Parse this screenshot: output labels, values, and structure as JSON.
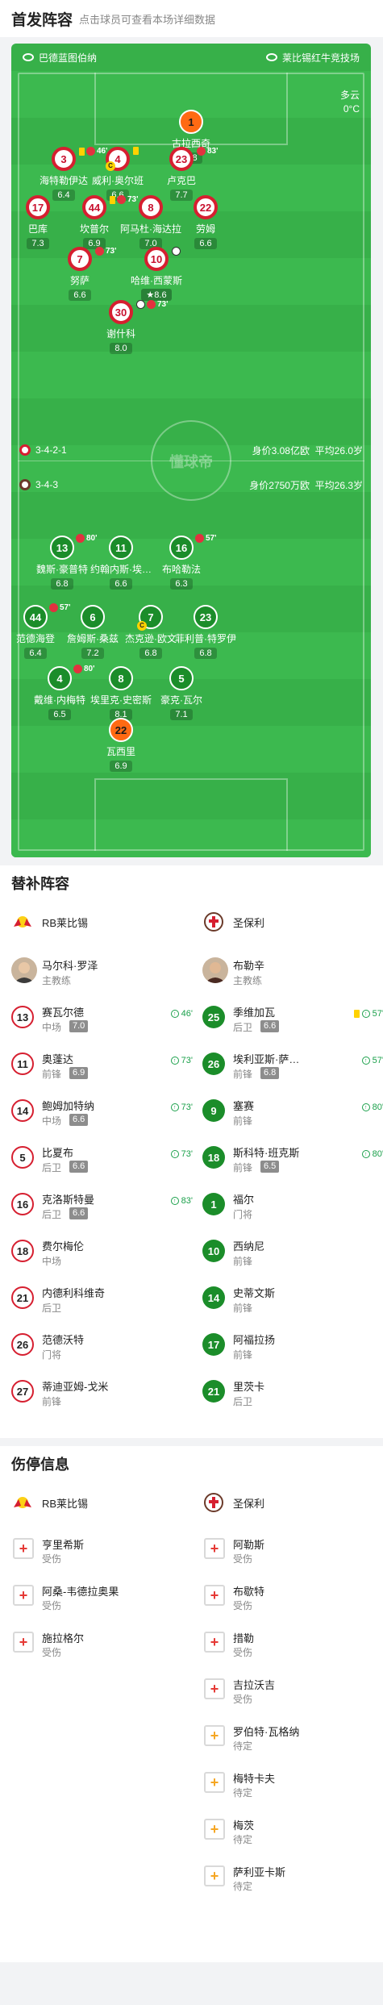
{
  "header": {
    "title": "首发阵容",
    "subtitle": "点击球员可查看本场详细数据"
  },
  "pitch": {
    "home_venue": "巴德蓝图伯纳",
    "away_venue": "莱比锡红牛竞技场",
    "weather": "多云",
    "temperature": "0°C",
    "home_formation": "3-4-2-1",
    "home_value": "身价3.08亿欧",
    "home_age": "平均26.0岁",
    "away_formation": "3-4-3",
    "away_value": "身价2750万欧",
    "away_age": "平均26.3岁",
    "watermark": "懂球帝",
    "home_players": [
      {
        "num": "1",
        "name": "古拉西奇",
        "rating": "7.8",
        "gk": true
      },
      {
        "num": "3",
        "name": "海特勒伊达",
        "rating": "6.4",
        "sub": "46'",
        "card": true
      },
      {
        "num": "4",
        "name": "威利·奥尔班",
        "rating": "6.6",
        "cap": true,
        "card": true
      },
      {
        "num": "23",
        "name": "卢克巴",
        "rating": "7.7",
        "sub": "83'"
      },
      {
        "num": "17",
        "name": "巴库",
        "rating": "7.3"
      },
      {
        "num": "44",
        "name": "坎普尔",
        "rating": "6.9",
        "sub": "73'",
        "card": true
      },
      {
        "num": "8",
        "name": "阿马杜·海达拉",
        "rating": "7.0"
      },
      {
        "num": "22",
        "name": "劳姆",
        "rating": "6.6"
      },
      {
        "num": "7",
        "name": "努萨",
        "rating": "6.6",
        "sub": "73'"
      },
      {
        "num": "10",
        "name": "哈维·西蒙斯",
        "rating": "8.6",
        "star": true,
        "goal": true
      },
      {
        "num": "30",
        "name": "谢什科",
        "rating": "8.0",
        "sub": "73'",
        "goal": true
      }
    ],
    "away_players": [
      {
        "num": "13",
        "name": "魏斯·豪普特",
        "rating": "6.8",
        "sub": "80'"
      },
      {
        "num": "11",
        "name": "约翰内斯·埃…",
        "rating": "6.6"
      },
      {
        "num": "16",
        "name": "布哈勒法",
        "rating": "6.3",
        "sub": "57'"
      },
      {
        "num": "44",
        "name": "范德海登",
        "rating": "6.4",
        "sub": "57'"
      },
      {
        "num": "6",
        "name": "詹姆斯·桑兹",
        "rating": "7.2"
      },
      {
        "num": "7",
        "name": "杰克逊·欧文",
        "rating": "6.8",
        "cap": true
      },
      {
        "num": "23",
        "name": "菲利普·特罗伊",
        "rating": "6.8"
      },
      {
        "num": "4",
        "name": "戴维·内梅特",
        "rating": "6.5",
        "sub": "80'"
      },
      {
        "num": "8",
        "name": "埃里克·史密斯",
        "rating": "8.1"
      },
      {
        "num": "5",
        "name": "豪克·瓦尔",
        "rating": "7.1"
      },
      {
        "num": "22",
        "name": "瓦西里",
        "rating": "6.9",
        "gk": true
      }
    ]
  },
  "subs": {
    "title": "替补阵容",
    "home_team": "RB莱比锡",
    "away_team": "圣保利",
    "home_coach": {
      "name": "马尔科·罗泽",
      "role": "主教练"
    },
    "away_coach": {
      "name": "布勒辛",
      "role": "主教练"
    },
    "home": [
      {
        "num": "13",
        "name": "赛瓦尔德",
        "pos": "中场",
        "rating": "7.0",
        "min": "46'"
      },
      {
        "num": "11",
        "name": "奥蓬达",
        "pos": "前锋",
        "rating": "6.9",
        "min": "73'"
      },
      {
        "num": "14",
        "name": "鲍姆加特纳",
        "pos": "中场",
        "rating": "6.6",
        "min": "73'"
      },
      {
        "num": "5",
        "name": "比夏布",
        "pos": "后卫",
        "rating": "6.6",
        "min": "73'"
      },
      {
        "num": "16",
        "name": "克洛斯特曼",
        "pos": "后卫",
        "rating": "6.6",
        "min": "83'"
      },
      {
        "num": "18",
        "name": "费尔梅伦",
        "pos": "中场"
      },
      {
        "num": "21",
        "name": "内德利科维奇",
        "pos": "后卫"
      },
      {
        "num": "26",
        "name": "范德沃特",
        "pos": "门将"
      },
      {
        "num": "27",
        "name": "蒂迪亚姆-戈米",
        "pos": "前锋"
      }
    ],
    "away": [
      {
        "num": "25",
        "name": "季维加瓦",
        "pos": "后卫",
        "rating": "6.6",
        "min": "57'",
        "card": true
      },
      {
        "num": "26",
        "name": "埃利亚斯·萨…",
        "pos": "前锋",
        "rating": "6.8",
        "min": "57'"
      },
      {
        "num": "9",
        "name": "塞赛",
        "pos": "前锋",
        "min": "80'"
      },
      {
        "num": "18",
        "name": "斯科特·班克斯",
        "pos": "前锋",
        "rating": "6.5",
        "min": "80'"
      },
      {
        "num": "1",
        "name": "福尔",
        "pos": "门将"
      },
      {
        "num": "10",
        "name": "西纳尼",
        "pos": "前锋"
      },
      {
        "num": "14",
        "name": "史蒂文斯",
        "pos": "前锋"
      },
      {
        "num": "17",
        "name": "阿福拉扬",
        "pos": "前锋"
      },
      {
        "num": "21",
        "name": "里茨卡",
        "pos": "后卫"
      }
    ]
  },
  "injuries": {
    "title": "伤停信息",
    "home_team": "RB莱比锡",
    "away_team": "圣保利",
    "home": [
      {
        "name": "亨里希斯",
        "status": "受伤"
      },
      {
        "name": "阿桑-韦德拉奥果",
        "status": "受伤"
      },
      {
        "name": "施拉格尔",
        "status": "受伤"
      }
    ],
    "away": [
      {
        "name": "阿勒斯",
        "status": "受伤"
      },
      {
        "name": "布歇特",
        "status": "受伤"
      },
      {
        "name": "措勒",
        "status": "受伤"
      },
      {
        "name": "吉拉沃吉",
        "status": "受伤"
      },
      {
        "name": "罗伯特·瓦格纳",
        "status": "待定",
        "wait": true
      },
      {
        "name": "梅特卡夫",
        "status": "待定",
        "wait": true
      },
      {
        "name": "梅茨",
        "status": "待定",
        "wait": true
      },
      {
        "name": "萨利亚卡斯",
        "status": "待定",
        "wait": true
      }
    ]
  },
  "colors": {
    "pitch": "#37b049",
    "home": "#d61f30",
    "away": "#1b8d2a",
    "gk": "#ff6a13"
  }
}
